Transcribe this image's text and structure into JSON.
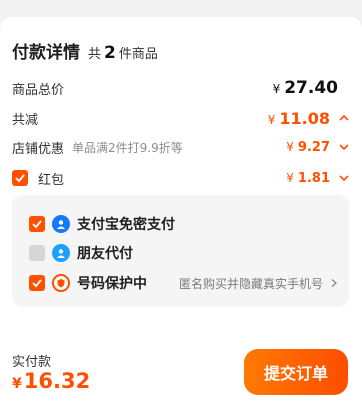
{
  "header": {
    "title": "付款详情",
    "count_prefix": "共",
    "count_value": "2",
    "count_suffix": "件商品"
  },
  "rows": {
    "total": {
      "label": "商品总价",
      "currency": "¥",
      "value": "27.40"
    },
    "discount": {
      "label": "共减",
      "currency": "¥",
      "value": "11.08"
    },
    "shop": {
      "label": "店铺优惠",
      "sub": "单品满2件打9.9折等",
      "currency": "¥",
      "value": "9.27"
    },
    "redpacket": {
      "label": "红包",
      "currency": "¥",
      "value": "1.81",
      "checked": true
    }
  },
  "payment": {
    "items": [
      {
        "label": "支付宝免密支付",
        "checked": true,
        "icon": "alipay-user-icon"
      },
      {
        "label": "朋友代付",
        "checked": false,
        "icon": "friend-pay-icon"
      },
      {
        "label": "号码保护中",
        "checked": true,
        "icon": "shield-icon",
        "note": "匿名购买并隐藏真实手机号"
      }
    ]
  },
  "footer": {
    "label": "实付款",
    "currency": "¥",
    "value": "16.32",
    "submit_label": "提交订单"
  },
  "colors": {
    "accent": "#ff5000",
    "pay_icon_blue": "#1677ff",
    "shield_orange": "#ff5000"
  }
}
